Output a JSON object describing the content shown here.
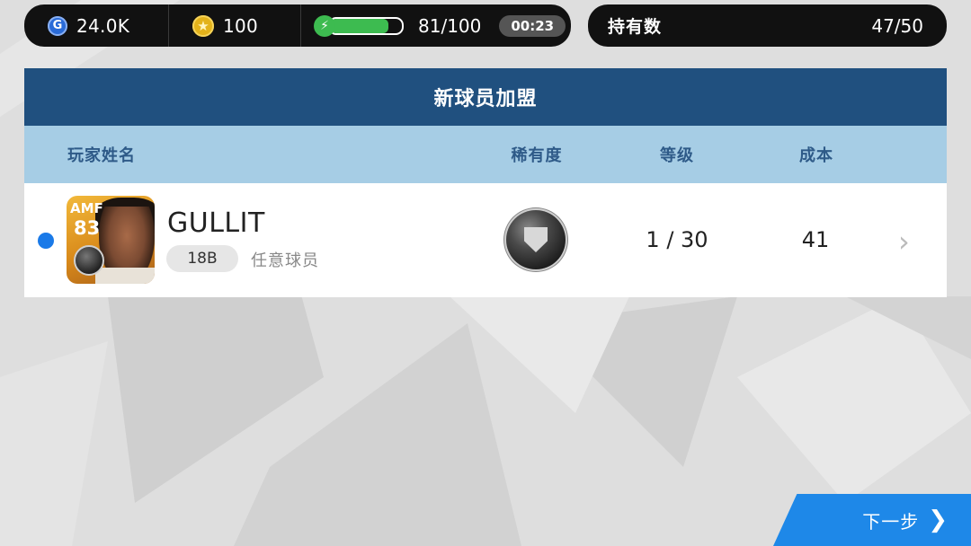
{
  "topbar": {
    "gp_icon": "G",
    "gp_value": "24.0K",
    "coin_value": "100",
    "energy_value": "81/100",
    "energy_fraction": 0.81,
    "timer": "00:23"
  },
  "owned": {
    "label": "持有数",
    "value": "47/50"
  },
  "panel": {
    "title": "新球员加盟",
    "columns": {
      "name": "玩家姓名",
      "rarity": "稀有度",
      "level": "等级",
      "cost": "成本"
    },
    "player": {
      "position": "AMF",
      "rating": "83",
      "name": "GULLIT",
      "ovr_badge": "18B",
      "type": "任意球员",
      "level": "1 / 30",
      "cost": "41"
    }
  },
  "next_button": {
    "label": "下一步"
  },
  "colors": {
    "title_bar": "#20507f",
    "header_row": "#a6cde5",
    "accent": "#1e88e8",
    "energy": "#3dbb50"
  }
}
